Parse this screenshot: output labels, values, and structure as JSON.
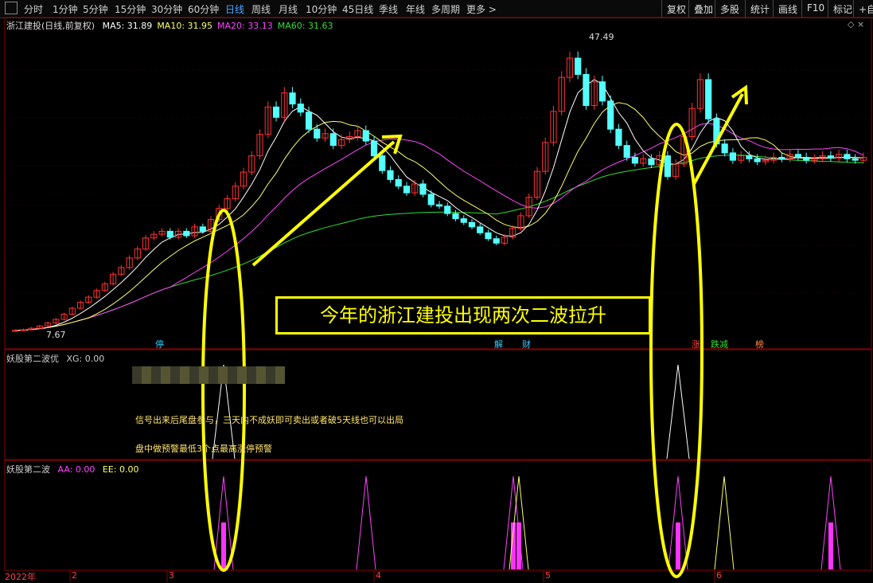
{
  "toolbar": {
    "periods": [
      "分时",
      "1分钟",
      "5分钟",
      "15分钟",
      "30分钟",
      "60分钟",
      "日线",
      "周线",
      "月线",
      "10分钟",
      "45日线",
      "季线",
      "年线",
      "多周期",
      "更多 >"
    ],
    "active_period": "日线",
    "right_buttons": [
      "复权",
      "叠加",
      "多股",
      "统计",
      "画线",
      "F10",
      "标记",
      "+自"
    ]
  },
  "main_chart": {
    "stock_title": "浙江建投(日线,前复权)",
    "ma_legend": [
      {
        "label": "MA5: 31.89",
        "color": "#ffffff"
      },
      {
        "label": "MA10: 31.95",
        "color": "#ffff66"
      },
      {
        "label": "MA20: 33.13",
        "color": "#ff44ff"
      },
      {
        "label": "MA60: 31.63",
        "color": "#33dd33"
      }
    ],
    "high_label": "47.49",
    "low_label": "7.67",
    "callout": "今年的浙江建投出现两次二波拉升",
    "events": [
      {
        "text": "停",
        "color": "#33ccff"
      },
      {
        "text": "解",
        "color": "#33ccff"
      },
      {
        "text": "财",
        "color": "#33ccff"
      },
      {
        "text": "涨",
        "color": "#ff4444"
      },
      {
        "text": "跌减",
        "color": "#33dd33"
      },
      {
        "text": "榜",
        "color": "#ff8844"
      }
    ]
  },
  "indicator1": {
    "title": "妖股第二波优",
    "xg": "XG: 0.00",
    "note1": "信号出来后尾盘参与，三天内不成妖即可卖出或者破5天线也可以出局",
    "note2": "盘中做预警最低3个点最高涨停预警"
  },
  "indicator2": {
    "title": "妖股第二波",
    "aa": "AA: 0.00",
    "ee": "EE: 0.00"
  },
  "x_axis": {
    "year": "2022年",
    "months": [
      "2",
      "3",
      "4",
      "5",
      "6"
    ]
  },
  "chart_data": {
    "type": "candlestick",
    "title": "浙江建投(日线,前复权)",
    "ylim": [
      7.67,
      47.49
    ],
    "closes": [
      8.0,
      8.1,
      8.3,
      8.6,
      9.0,
      9.5,
      10.2,
      11.0,
      11.8,
      12.5,
      13.4,
      14.3,
      15.6,
      16.5,
      17.8,
      19.0,
      20.5,
      21.0,
      21.4,
      20.6,
      21.4,
      20.8,
      22.0,
      21.4,
      23.0,
      24.5,
      25.8,
      27.5,
      29.4,
      31.6,
      34.5,
      38.2,
      36.8,
      40.1,
      38.6,
      37.5,
      35.2,
      34.0,
      34.6,
      33.0,
      33.8,
      34.2,
      35.0,
      33.6,
      31.6,
      29.6,
      28.4,
      27.5,
      26.6,
      27.8,
      26.4,
      25.0,
      24.8,
      23.8,
      23.1,
      22.6,
      22.0,
      21.2,
      20.4,
      19.8,
      20.6,
      21.8,
      23.5,
      26.0,
      29.5,
      33.4,
      37.6,
      42.2,
      44.8,
      42.6,
      38.4,
      41.6,
      39.0,
      35.2,
      33.0,
      31.4,
      30.6,
      31.2,
      30.4,
      31.6,
      28.8,
      30.5,
      34.2,
      38.0,
      41.9,
      36.6,
      33.2,
      32.0,
      31.0,
      31.6,
      31.2,
      30.8,
      31.0,
      31.4,
      31.2,
      31.8,
      31.4,
      31.0,
      31.2,
      31.6,
      31.3,
      31.8,
      31.2,
      31.0,
      31.4
    ]
  }
}
